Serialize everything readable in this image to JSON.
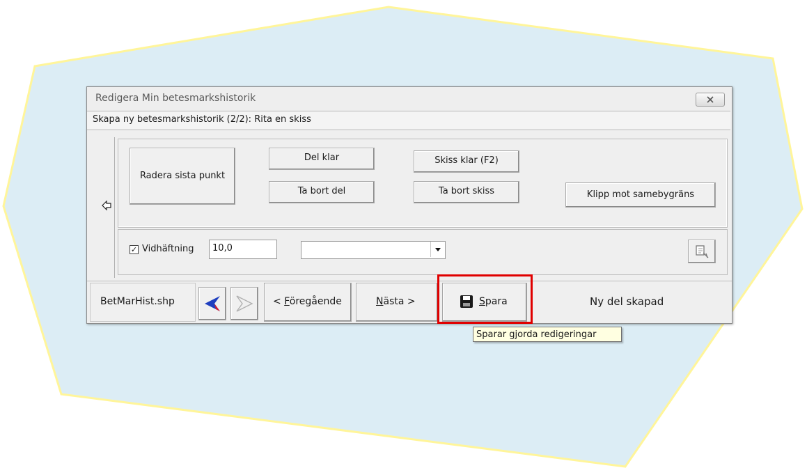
{
  "window": {
    "title": "Redigera Min betesmarkshistorik",
    "close_icon": "close-icon"
  },
  "subheader": "Skapa ny betesmarkshistorik (2/2): Rita en skiss",
  "tools": {
    "back_icon": "back-arrow-icon",
    "radera_sista_punkt": "Radera sista punkt",
    "del_klar": "Del klar",
    "ta_bort_del": "Ta bort del",
    "skiss_klar": "Skiss klar (F2)",
    "ta_bort_skiss": "Ta bort skiss",
    "klipp_mot_samebygrans": "Klipp mot samebygräns"
  },
  "options": {
    "vidhaftning_checked": true,
    "vidhaftning_label": "Vidhäftning",
    "vidhaftning_value": "10,0",
    "dropdown_value": "",
    "tool_icon": "edit-tool-icon"
  },
  "bottom": {
    "file_name": "BetMarHist.shp",
    "prev_arrow_icon": "blue-left-arrow-icon",
    "next_arrow_icon": "grey-right-arrow-icon",
    "foregaende_prefix": "< ",
    "foregaende_acc": "F",
    "foregaende_rest": "öregående",
    "nasta_acc": "N",
    "nasta_rest": "ästa >",
    "spara_icon": "floppy-disk-icon",
    "spara_acc": "S",
    "spara_rest": "para",
    "status": "Ny del skapad"
  },
  "tooltip": "Sparar gjorda redigeringar",
  "colors": {
    "background_shape": "#dcedf5",
    "background_shape_border": "#fff59a",
    "highlight": "#e00000",
    "arrow_blue": "#1f3fbf"
  }
}
